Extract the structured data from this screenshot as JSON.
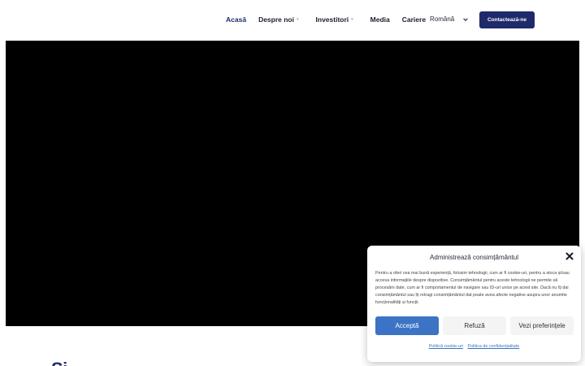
{
  "nav": {
    "items": [
      {
        "label": "Acasă",
        "active": true,
        "has_dropdown": false
      },
      {
        "label": "Despre noi",
        "active": false,
        "has_dropdown": true
      },
      {
        "label": "Investitori",
        "active": false,
        "has_dropdown": true
      },
      {
        "label": "Media",
        "active": false,
        "has_dropdown": false
      },
      {
        "label": "Cariere",
        "active": false,
        "has_dropdown": false
      }
    ]
  },
  "language": {
    "selected": "Română",
    "icon": "chevron-down-icon"
  },
  "contact_button": "Contactează-ne",
  "section": {
    "title_partial": "Si"
  },
  "cookie": {
    "title": "Administrează consimțământul",
    "close_icon": "close-icon",
    "text": "Pentru a oferi cea mai bună experiență, folosim tehnologii, cum ar fi cookie-uri, pentru a stoca și/sau accesa informațiile despre dispozitive. Consimțământul pentru aceste tehnologii ne permite să procesăm date, cum ar fi comportamentul de navigare sau ID-uri unice pe acest site. Dacă nu îți dai consimțământul sau îți retragi consimțământul dat poate avea afecte negative asupra unor anumite funcționalități și funcții.",
    "accept": "Acceptă",
    "refuse": "Refuză",
    "preferences": "Vezi preferințele",
    "link_cookie_policy": "Politică cookie-uri",
    "link_privacy_policy": "Politica de confidențialitate"
  },
  "colors": {
    "brand": "#1f2a6b",
    "accept": "#3d73c4"
  }
}
